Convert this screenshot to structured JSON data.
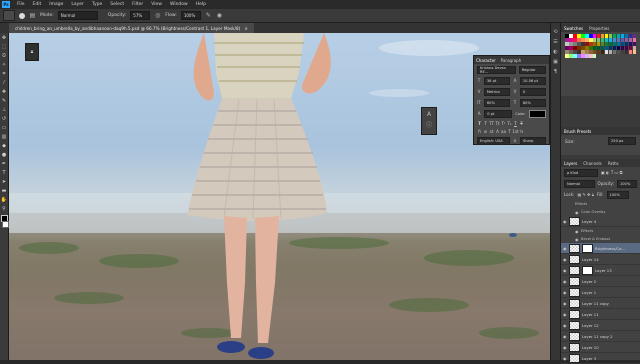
{
  "menubar": {
    "logo": "Ps",
    "items": [
      "File",
      "Edit",
      "Image",
      "Layer",
      "Type",
      "Select",
      "Filter",
      "View",
      "Window",
      "Help"
    ]
  },
  "options": {
    "mode_label": "Mode:",
    "mode_value": "Normal",
    "opacity_label": "Opacity:",
    "opacity_value": "57%",
    "flow_label": "Flow:",
    "flow_value": "100%"
  },
  "document_tab": {
    "title": "children_bring_an_umbrella_by_andibhaanoon-daq9h.5.psd @ 66.7% (Brightness/Contrast 1, Layer Mask/8)",
    "close": "×"
  },
  "character_panel": {
    "tabs": [
      "Character",
      "Paragraph"
    ],
    "font_family": "Krishna Devsn RE…",
    "font_style": "Regular",
    "size": "36 pt",
    "leading": "10.56 pt",
    "kerning": "Metrics",
    "tracking": "0",
    "vscale": "60%",
    "hscale": "80%",
    "baseline": "0 pt",
    "color_label": "Color:",
    "glyph_buttons": [
      "T",
      "T",
      "TT",
      "Tt",
      "T¹",
      "T₁",
      "T",
      "T"
    ],
    "ot_buttons": [
      "fi",
      "ø",
      "st",
      "A",
      "aa",
      "T",
      "1st",
      "½"
    ],
    "language": "English: USA",
    "antialias": "a",
    "aa_value": "Sharp"
  },
  "swatches_panel": {
    "tabs": [
      "Swatches",
      "Properties"
    ],
    "colors": [
      "#000000",
      "#ffffff",
      "#ff0000",
      "#ffff00",
      "#00ff00",
      "#00ffff",
      "#0000ff",
      "#ff00ff",
      "#ed1c24",
      "#f7941d",
      "#fff200",
      "#8dc63f",
      "#00a651",
      "#00a99d",
      "#00aeef",
      "#0072bc",
      "#2e3192",
      "#662d91",
      "#92278f",
      "#ec008c",
      "#ed145b",
      "#f26c4f",
      "#f68e56",
      "#fbaf5d",
      "#fff568",
      "#acd373",
      "#7cc576",
      "#3bb878",
      "#1abbb4",
      "#00bff3",
      "#438ccb",
      "#5574b9",
      "#605ca8",
      "#855fa8",
      "#a763a8",
      "#f06eaa",
      "#c6c6c6",
      "#959595",
      "#7d7d7d",
      "#555555",
      "#363636",
      "#9e0b0f",
      "#a0410d",
      "#a3620a",
      "#aba000",
      "#598527",
      "#197b30",
      "#007236",
      "#00746b",
      "#0076a3",
      "#004b80",
      "#003471",
      "#1b1464",
      "#440e62",
      "#630460",
      "#9e005d",
      "#790000",
      "#7b2e00",
      "#7d4900",
      "#827b00",
      "#406618",
      "#005e20",
      "#005826",
      "#005952",
      "#005b7f",
      "#003663",
      "#002157",
      "#0d004c",
      "#32004b",
      "#4b0049",
      "#7b0046",
      "#c7b299",
      "#998675",
      "#736357",
      "#534741",
      "#37302d",
      "#c69c6d",
      "#a67c52",
      "#8c6239",
      "#754c24",
      "#603913",
      "#3c2415",
      "#e0e0e0",
      "#b0b0b0",
      "#707070",
      "#505050",
      "#404040",
      "#303030",
      "#ff8080",
      "#ffc080",
      "#ffff80",
      "#80ff80",
      "#80ffff",
      "#8080ff",
      "#ff80ff",
      "#c0c0ff",
      "#ffc0c0",
      "#c0ffc0"
    ]
  },
  "brush_panel": {
    "title": "Brush Presets",
    "size_label": "Size:",
    "size_value": "250 px"
  },
  "layers_panel": {
    "tabs": [
      "Layers",
      "Channels",
      "Paths"
    ],
    "kind": "ρ Kind",
    "blend": "Normal",
    "opacity_label": "Opacity:",
    "opacity_value": "100%",
    "lock_label": "Lock:",
    "fill_label": "Fill:",
    "fill_value": "100%",
    "effects_items": [
      "Effects",
      "Color Overlay"
    ],
    "layers": [
      {
        "name": "Layer 4",
        "mask": false,
        "selected": false
      },
      {
        "name": "Effects",
        "sub": true
      },
      {
        "name": "Bevel & Emboss",
        "sub": true
      },
      {
        "name": "Brightness/Co…",
        "mask": true,
        "selected": true
      },
      {
        "name": "Layer 14",
        "mask": false,
        "selected": false
      },
      {
        "name": "Layer 13",
        "mask": true,
        "selected": false
      },
      {
        "name": "Layer 2",
        "mask": false,
        "selected": false
      },
      {
        "name": "Layer 1",
        "mask": false,
        "selected": false
      },
      {
        "name": "Layer 11 copy",
        "mask": false,
        "selected": false
      },
      {
        "name": "Layer 11",
        "mask": false,
        "selected": false
      },
      {
        "name": "Layer 12",
        "mask": false,
        "selected": false
      },
      {
        "name": "Layer 11 copy 2",
        "mask": false,
        "selected": false
      },
      {
        "name": "Layer 10",
        "mask": false,
        "selected": false
      },
      {
        "name": "Layer 3",
        "mask": false,
        "selected": false
      }
    ]
  },
  "tools": [
    "move",
    "marquee",
    "lasso",
    "quick-select",
    "crop",
    "eyedropper",
    "healing",
    "brush",
    "stamp",
    "history",
    "eraser",
    "gradient",
    "blur",
    "dodge",
    "pen",
    "type",
    "path-select",
    "shape",
    "hand",
    "zoom"
  ]
}
